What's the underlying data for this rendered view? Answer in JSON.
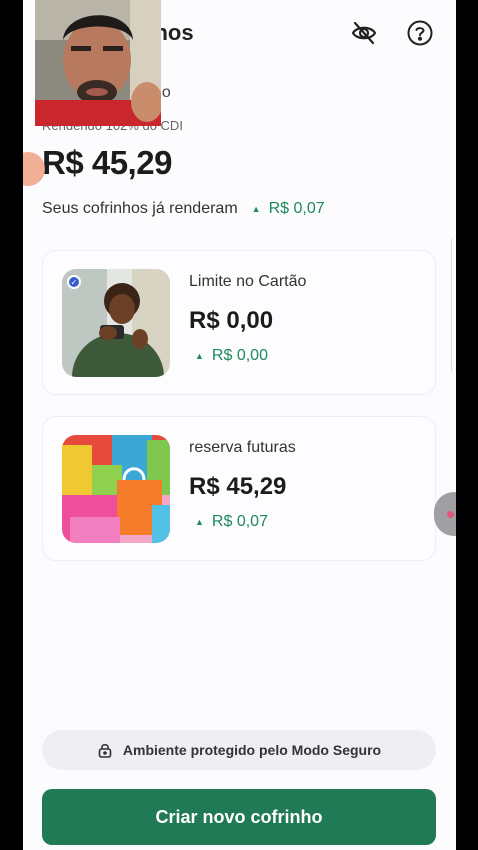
{
  "header": {
    "title": "nhos",
    "hide_icon": "eye-off-icon",
    "help_icon": "question-circle-icon"
  },
  "summary": {
    "balance_label": "do",
    "yield_label": "Rendendo 102% do CDI",
    "total": "R$ 45,29",
    "earned_label": "Seus cofrinhos já renderam",
    "earned_amount": "R$ 0,07"
  },
  "piggies": [
    {
      "name": "Limite no Cartão",
      "amount": "R$ 0,00",
      "yield": "R$ 0,00",
      "selected": true
    },
    {
      "name": "reserva futuras",
      "amount": "R$ 45,29",
      "yield": "R$ 0,07",
      "selected": false
    }
  ],
  "footer": {
    "secure_text": "Ambiente protegido pelo Modo Seguro",
    "create_label": "Criar novo cofrinho"
  },
  "colors": {
    "accent_green": "#1f7a55",
    "positive_green": "#1f8a5b",
    "background": "#fcfbfd"
  }
}
